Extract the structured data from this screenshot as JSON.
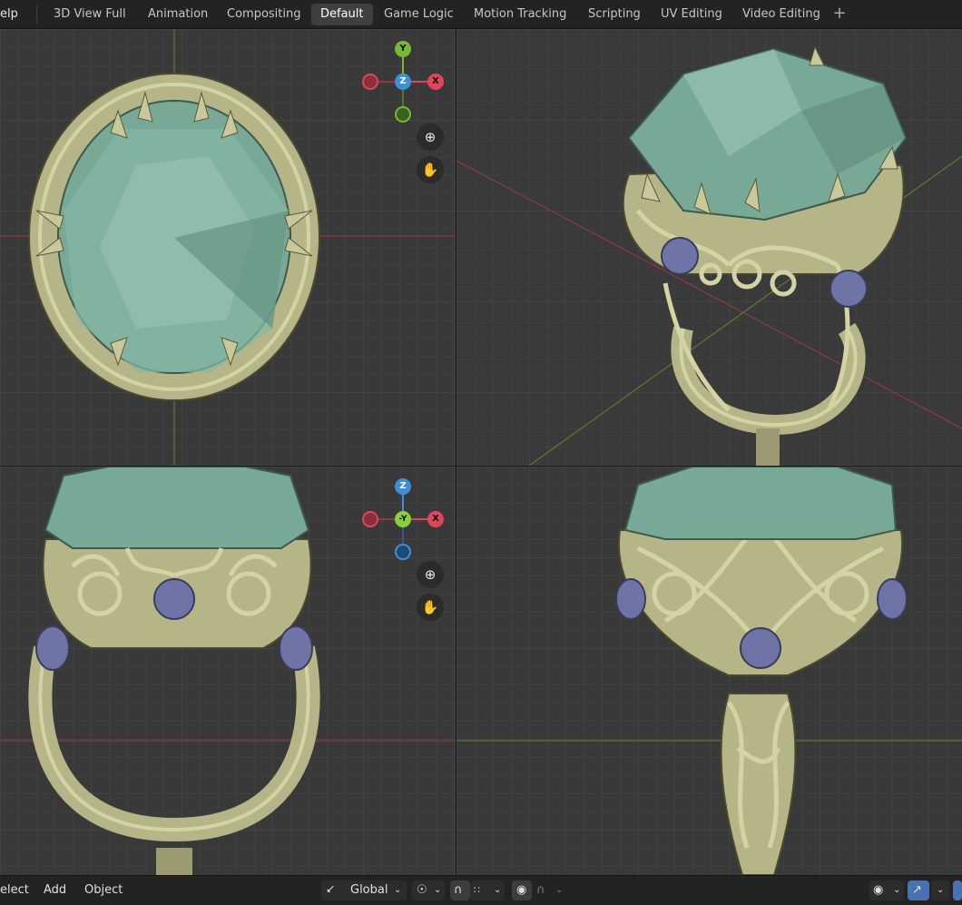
{
  "header": {
    "help_menu": "elp",
    "tabs": [
      {
        "label": "3D View Full"
      },
      {
        "label": "Animation"
      },
      {
        "label": "Compositing"
      },
      {
        "label": "Default",
        "active": true
      },
      {
        "label": "Game Logic"
      },
      {
        "label": "Motion Tracking"
      },
      {
        "label": "Scripting"
      },
      {
        "label": "UV Editing"
      },
      {
        "label": "Video Editing"
      }
    ],
    "add_tab_label": "+"
  },
  "viewports": {
    "top": {
      "gizmo": {
        "up": "Y",
        "center": "Z",
        "right": "X"
      },
      "zoom_icon": "zoom-in-icon",
      "pan_icon": "hand-icon"
    },
    "front": {
      "gizmo": {
        "up": "Z",
        "center": "-Y",
        "right": "X"
      },
      "zoom_icon": "zoom-in-icon",
      "pan_icon": "hand-icon"
    },
    "colors": {
      "x_axis": "#e0465a",
      "y_axis": "#78b832",
      "z_axis": "#3d8fd8",
      "metal": "#b6b587",
      "gem": "#76a896",
      "side_stone": "#6f74a7"
    }
  },
  "footer": {
    "menus": [
      "elect",
      "Add",
      "Object"
    ],
    "orientation": {
      "label": "Global"
    },
    "icons": [
      "transform-orientation-icon",
      "pivot-icon",
      "snap-icon",
      "snap-increment-icon",
      "proportional-edit-icon",
      "falloff-icon",
      "visibility-icon",
      "gizmo-icon"
    ]
  }
}
